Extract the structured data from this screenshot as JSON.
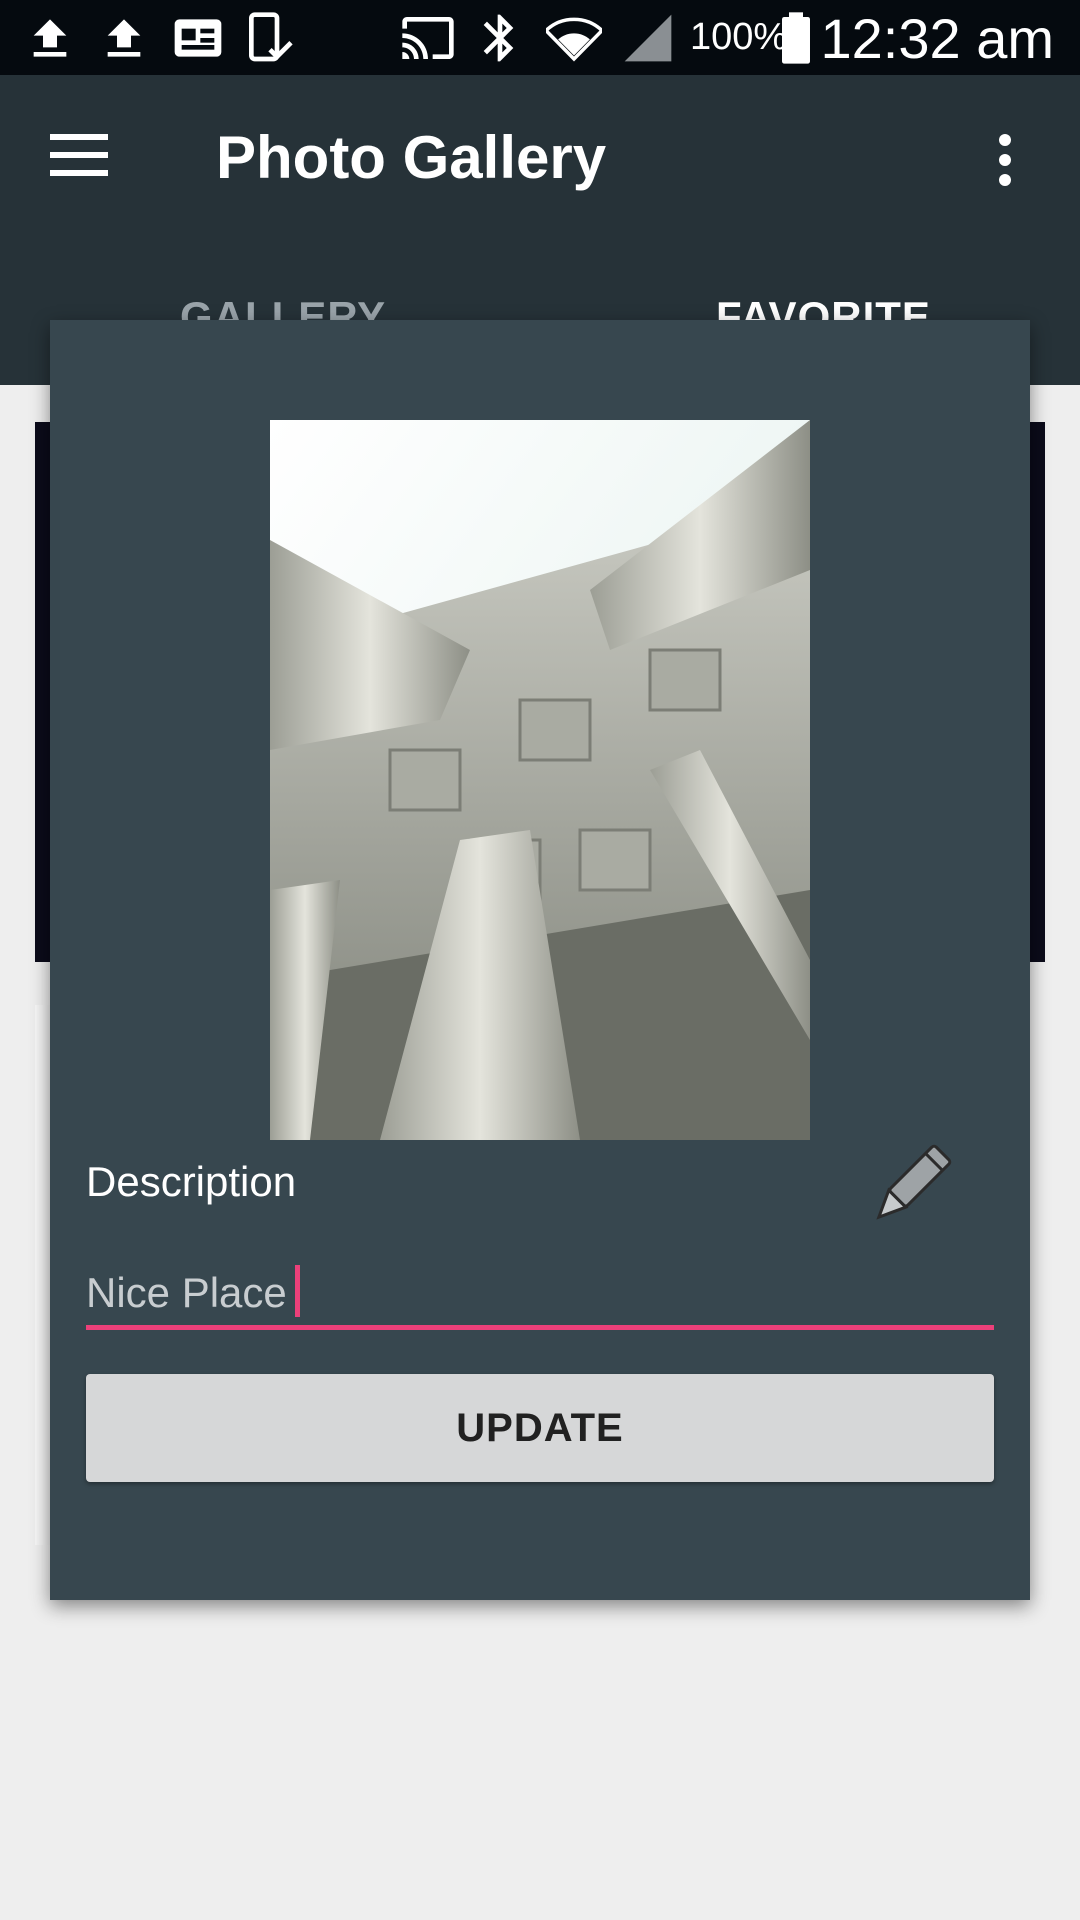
{
  "status_bar": {
    "icons": [
      "upload-icon",
      "upload-icon",
      "news-icon",
      "tablet-check-icon",
      "cast-icon",
      "bluetooth-icon",
      "wifi-icon",
      "signal-icon",
      "battery-icon"
    ],
    "battery_percent": "100%",
    "time": "12:32 am"
  },
  "app_bar": {
    "title": "Photo Gallery",
    "menu_icon": "hamburger-menu-icon",
    "overflow_icon": "more-vert-icon",
    "background_color": "#263238"
  },
  "tabs": [
    {
      "label": "GALLERY",
      "selected": false
    },
    {
      "label": "FAVORITE",
      "selected": true
    }
  ],
  "dialog": {
    "background_color": "#37474f",
    "photo_icon": "photo-columns",
    "description_label": "Description",
    "edit_icon": "pencil-icon",
    "description_value": "Nice Place",
    "accent_color": "#ec407a",
    "update_label": "UPDATE"
  }
}
